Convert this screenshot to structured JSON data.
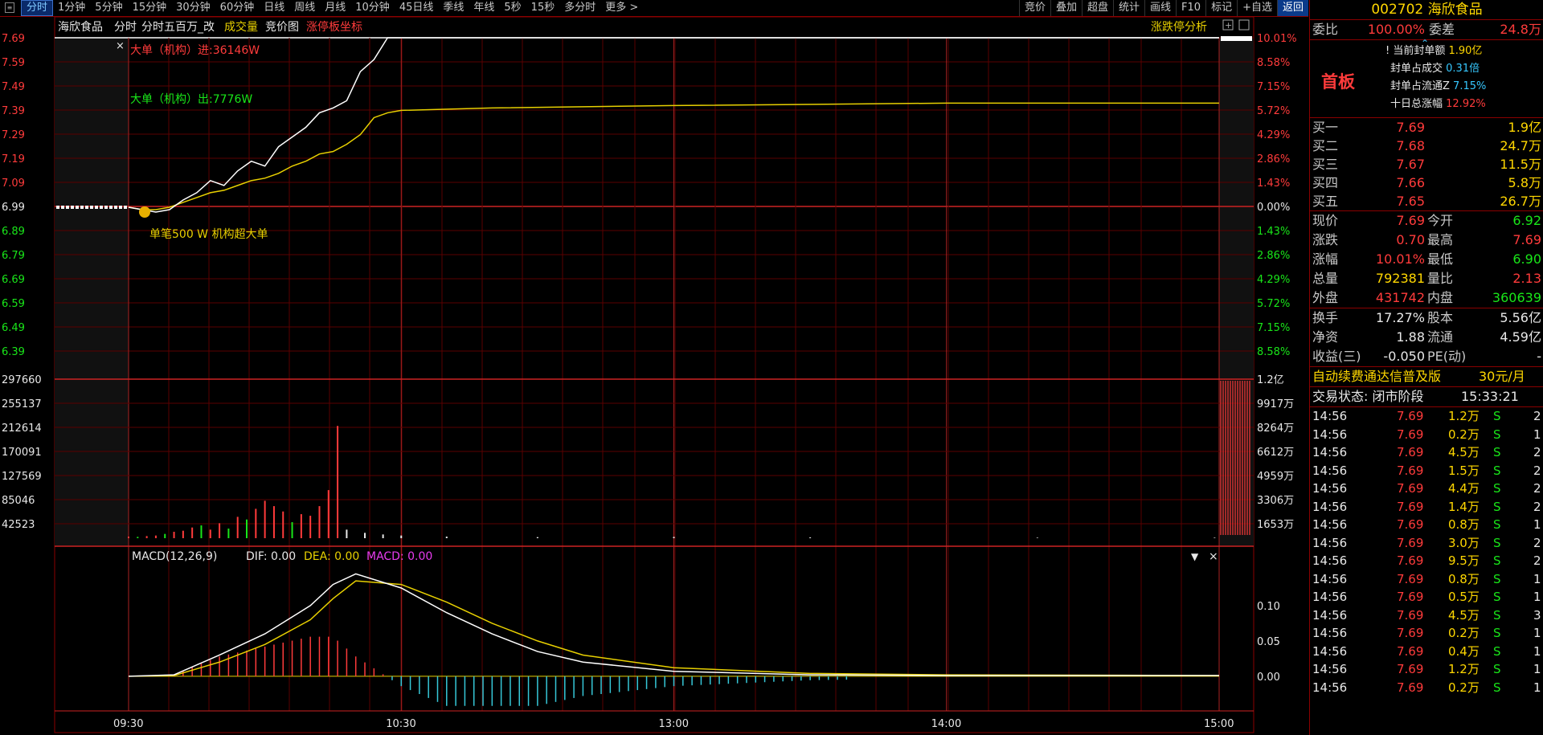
{
  "menu_icon": "menu-icon",
  "period_tabs": [
    "分时",
    "1分钟",
    "5分钟",
    "15分钟",
    "30分钟",
    "60分钟",
    "日线",
    "周线",
    "月线",
    "10分钟",
    "45日线",
    "季线",
    "年线",
    "5秒",
    "15秒",
    "多分时",
    "更多 >"
  ],
  "tool_tabs": [
    "竞价",
    "叠加",
    "超盘",
    "统计",
    "画线",
    "F10",
    "标记",
    "+自选",
    "返回"
  ],
  "chart_header": {
    "stock_name": "海欣食品",
    "items": [
      "分时",
      "分时五百万_改"
    ],
    "volume_label": "成交量",
    "auction_label": "竞价图",
    "limit_label": "涨停板坐标",
    "analysis_btn": "涨跌停分析"
  },
  "annotations": {
    "big_in": "大单（机构）进:36146W",
    "big_out": "大单（机构）出:7776W",
    "single_big": "单笔500 W 机构超大单",
    "coin_icon": "coin-icon"
  },
  "price_axis_left": [
    "7.69",
    "7.59",
    "7.49",
    "7.39",
    "7.29",
    "7.19",
    "7.09",
    "6.99",
    "6.89",
    "6.79",
    "6.69",
    "6.59",
    "6.49",
    "6.39"
  ],
  "pct_axis_right": [
    "10.01%",
    "8.58%",
    "7.15%",
    "5.72%",
    "4.29%",
    "2.86%",
    "1.43%",
    "0.00%",
    "1.43%",
    "2.86%",
    "4.29%",
    "5.72%",
    "7.15%",
    "8.58%"
  ],
  "vol_axis_left": [
    "297660",
    "255137",
    "212614",
    "170091",
    "127569",
    "85046",
    "42523"
  ],
  "vol_axis_right": [
    "1.2亿",
    "9917万",
    "8264万",
    "6612万",
    "4959万",
    "3306万",
    "1653万"
  ],
  "macd_header": {
    "name": "MACD(12,26,9)",
    "dif": "DIF: 0.00",
    "dea": "DEA: 0.00",
    "macd": "MACD: 0.00"
  },
  "macd_axis_right": [
    "0.10",
    "0.05",
    "0.00"
  ],
  "time_axis": [
    "09:30",
    "10:30",
    "13:00",
    "14:00",
    "15:00"
  ],
  "chart_data": {
    "type": "line",
    "prev_close": 6.99,
    "limit_up": 7.69,
    "price_series": {
      "name": "分时",
      "x": [
        0,
        3,
        6,
        9,
        12,
        15,
        18,
        21,
        24,
        27,
        30,
        33,
        36,
        39,
        42,
        45,
        48,
        51,
        54,
        57,
        60,
        240
      ],
      "y": [
        6.99,
        6.98,
        6.97,
        6.98,
        7.02,
        7.05,
        7.1,
        7.08,
        7.14,
        7.18,
        7.16,
        7.24,
        7.28,
        7.32,
        7.38,
        7.4,
        7.43,
        7.55,
        7.6,
        7.69,
        7.69,
        7.69
      ]
    },
    "avg_series": {
      "name": "均价",
      "x": [
        0,
        3,
        6,
        9,
        12,
        15,
        18,
        21,
        24,
        27,
        30,
        33,
        36,
        39,
        42,
        45,
        48,
        51,
        54,
        57,
        60,
        80,
        120,
        180,
        240
      ],
      "y": [
        6.99,
        6.98,
        6.98,
        6.99,
        7.01,
        7.03,
        7.05,
        7.06,
        7.08,
        7.1,
        7.11,
        7.13,
        7.16,
        7.18,
        7.21,
        7.22,
        7.25,
        7.29,
        7.36,
        7.38,
        7.39,
        7.4,
        7.41,
        7.42,
        7.42
      ]
    },
    "volume_bars": [
      [
        0,
        3000,
        "r"
      ],
      [
        2,
        2500,
        "g"
      ],
      [
        4,
        4000,
        "r"
      ],
      [
        6,
        5000,
        "r"
      ],
      [
        8,
        8000,
        "g"
      ],
      [
        10,
        12000,
        "r"
      ],
      [
        12,
        14000,
        "r"
      ],
      [
        14,
        20000,
        "r"
      ],
      [
        16,
        24000,
        "g"
      ],
      [
        18,
        16000,
        "r"
      ],
      [
        20,
        28000,
        "r"
      ],
      [
        22,
        18000,
        "g"
      ],
      [
        24,
        40000,
        "r"
      ],
      [
        26,
        35000,
        "g"
      ],
      [
        28,
        55000,
        "r"
      ],
      [
        30,
        70000,
        "r"
      ],
      [
        32,
        60000,
        "r"
      ],
      [
        34,
        50000,
        "r"
      ],
      [
        36,
        30000,
        "g"
      ],
      [
        38,
        45000,
        "r"
      ],
      [
        40,
        42000,
        "r"
      ],
      [
        42,
        60000,
        "r"
      ],
      [
        44,
        90000,
        "r"
      ],
      [
        46,
        210000,
        "r"
      ],
      [
        48,
        16000,
        "w"
      ],
      [
        52,
        10000,
        "w"
      ],
      [
        56,
        7000,
        "w"
      ],
      [
        60,
        5000,
        "w"
      ],
      [
        70,
        3000,
        "w"
      ],
      [
        90,
        2000,
        "w"
      ],
      [
        120,
        2500,
        "w"
      ],
      [
        150,
        1500,
        "w"
      ],
      [
        200,
        1000,
        "w"
      ],
      [
        239,
        1000,
        "w"
      ]
    ],
    "volume_ylim": [
      0,
      297660
    ],
    "macd_dif": {
      "x": [
        0,
        10,
        20,
        30,
        40,
        45,
        50,
        60,
        70,
        80,
        90,
        100,
        120,
        150,
        180,
        240
      ],
      "y": [
        0,
        0.002,
        0.03,
        0.06,
        0.1,
        0.13,
        0.145,
        0.125,
        0.09,
        0.06,
        0.035,
        0.02,
        0.007,
        0.002,
        0.001,
        0.001
      ]
    },
    "macd_dea": {
      "x": [
        0,
        10,
        20,
        30,
        40,
        45,
        50,
        60,
        70,
        80,
        90,
        100,
        120,
        150,
        180,
        240
      ],
      "y": [
        0,
        0.001,
        0.02,
        0.045,
        0.08,
        0.11,
        0.135,
        0.13,
        0.105,
        0.075,
        0.05,
        0.03,
        0.012,
        0.004,
        0.002,
        0.001
      ]
    },
    "macd_ylim": [
      -0.04,
      0.15
    ]
  },
  "right_panel": {
    "code": "002702",
    "name": "海欣食品",
    "weibi_label": "委比",
    "weibi": "100.00%",
    "weicha_label": "委差",
    "weicha": "24.8万",
    "arrow": "chevron-up-icon",
    "seal_title": "首板",
    "seal_lines": [
      {
        "label": "当前封单额",
        "value": "1.90亿",
        "color": "yellow"
      },
      {
        "label": "封单占成交",
        "value": "0.31倍",
        "color": "cyan"
      },
      {
        "label": "封单占流通Z",
        "value": "7.15%",
        "color": "cyan"
      },
      {
        "label": "十日总涨幅",
        "value": "12.92%",
        "color": "red"
      }
    ],
    "bids": [
      {
        "label": "买一",
        "price": "7.69",
        "vol": "1.9亿"
      },
      {
        "label": "买二",
        "price": "7.68",
        "vol": "24.7万"
      },
      {
        "label": "买三",
        "price": "7.67",
        "vol": "11.5万"
      },
      {
        "label": "买四",
        "price": "7.66",
        "vol": "5.8万"
      },
      {
        "label": "买五",
        "price": "7.65",
        "vol": "26.7万"
      }
    ],
    "quote": [
      {
        "l1": "现价",
        "v1": "7.69",
        "c1": "red",
        "l2": "今开",
        "v2": "6.92",
        "c2": "green"
      },
      {
        "l1": "涨跌",
        "v1": "0.70",
        "c1": "red",
        "l2": "最高",
        "v2": "7.69",
        "c2": "red"
      },
      {
        "l1": "涨幅",
        "v1": "10.01%",
        "c1": "red",
        "l2": "最低",
        "v2": "6.90",
        "c2": "green"
      },
      {
        "l1": "总量",
        "v1": "792381",
        "c1": "yellow",
        "l2": "量比",
        "v2": "2.13",
        "c2": "red"
      },
      {
        "l1": "外盘",
        "v1": "431742",
        "c1": "red",
        "l2": "内盘",
        "v2": "360639",
        "c2": "green"
      }
    ],
    "fundamentals": [
      {
        "l1": "换手",
        "v1": "17.27%",
        "l2": "股本",
        "v2": "5.56亿"
      },
      {
        "l1": "净资",
        "v1": "1.88",
        "l2": "流通",
        "v2": "4.59亿"
      },
      {
        "l1": "收益(三)",
        "v1": "-0.050",
        "l2": "PE(动)",
        "v2": "-"
      }
    ],
    "promo": "自动续费通达信普及版",
    "promo_price": "30元/月",
    "status_label": "交易状态: 闭市阶段",
    "status_time": "15:33:21",
    "ticks": [
      {
        "t": "14:56",
        "p": "7.69",
        "v": "1.2万",
        "s": "S",
        "n": "2"
      },
      {
        "t": "14:56",
        "p": "7.69",
        "v": "0.2万",
        "s": "S",
        "n": "1"
      },
      {
        "t": "14:56",
        "p": "7.69",
        "v": "4.5万",
        "s": "S",
        "n": "2"
      },
      {
        "t": "14:56",
        "p": "7.69",
        "v": "1.5万",
        "s": "S",
        "n": "2"
      },
      {
        "t": "14:56",
        "p": "7.69",
        "v": "4.4万",
        "s": "S",
        "n": "2"
      },
      {
        "t": "14:56",
        "p": "7.69",
        "v": "1.4万",
        "s": "S",
        "n": "2"
      },
      {
        "t": "14:56",
        "p": "7.69",
        "v": "0.8万",
        "s": "S",
        "n": "1"
      },
      {
        "t": "14:56",
        "p": "7.69",
        "v": "3.0万",
        "s": "S",
        "n": "2"
      },
      {
        "t": "14:56",
        "p": "7.69",
        "v": "9.5万",
        "s": "S",
        "n": "2"
      },
      {
        "t": "14:56",
        "p": "7.69",
        "v": "0.8万",
        "s": "S",
        "n": "1"
      },
      {
        "t": "14:56",
        "p": "7.69",
        "v": "0.5万",
        "s": "S",
        "n": "1"
      },
      {
        "t": "14:56",
        "p": "7.69",
        "v": "4.5万",
        "s": "S",
        "n": "3"
      },
      {
        "t": "14:56",
        "p": "7.69",
        "v": "0.2万",
        "s": "S",
        "n": "1"
      },
      {
        "t": "14:56",
        "p": "7.69",
        "v": "0.4万",
        "s": "S",
        "n": "1"
      },
      {
        "t": "14:56",
        "p": "7.69",
        "v": "1.2万",
        "s": "S",
        "n": "1"
      },
      {
        "t": "14:56",
        "p": "7.69",
        "v": "0.2万",
        "s": "S",
        "n": "1"
      }
    ]
  }
}
